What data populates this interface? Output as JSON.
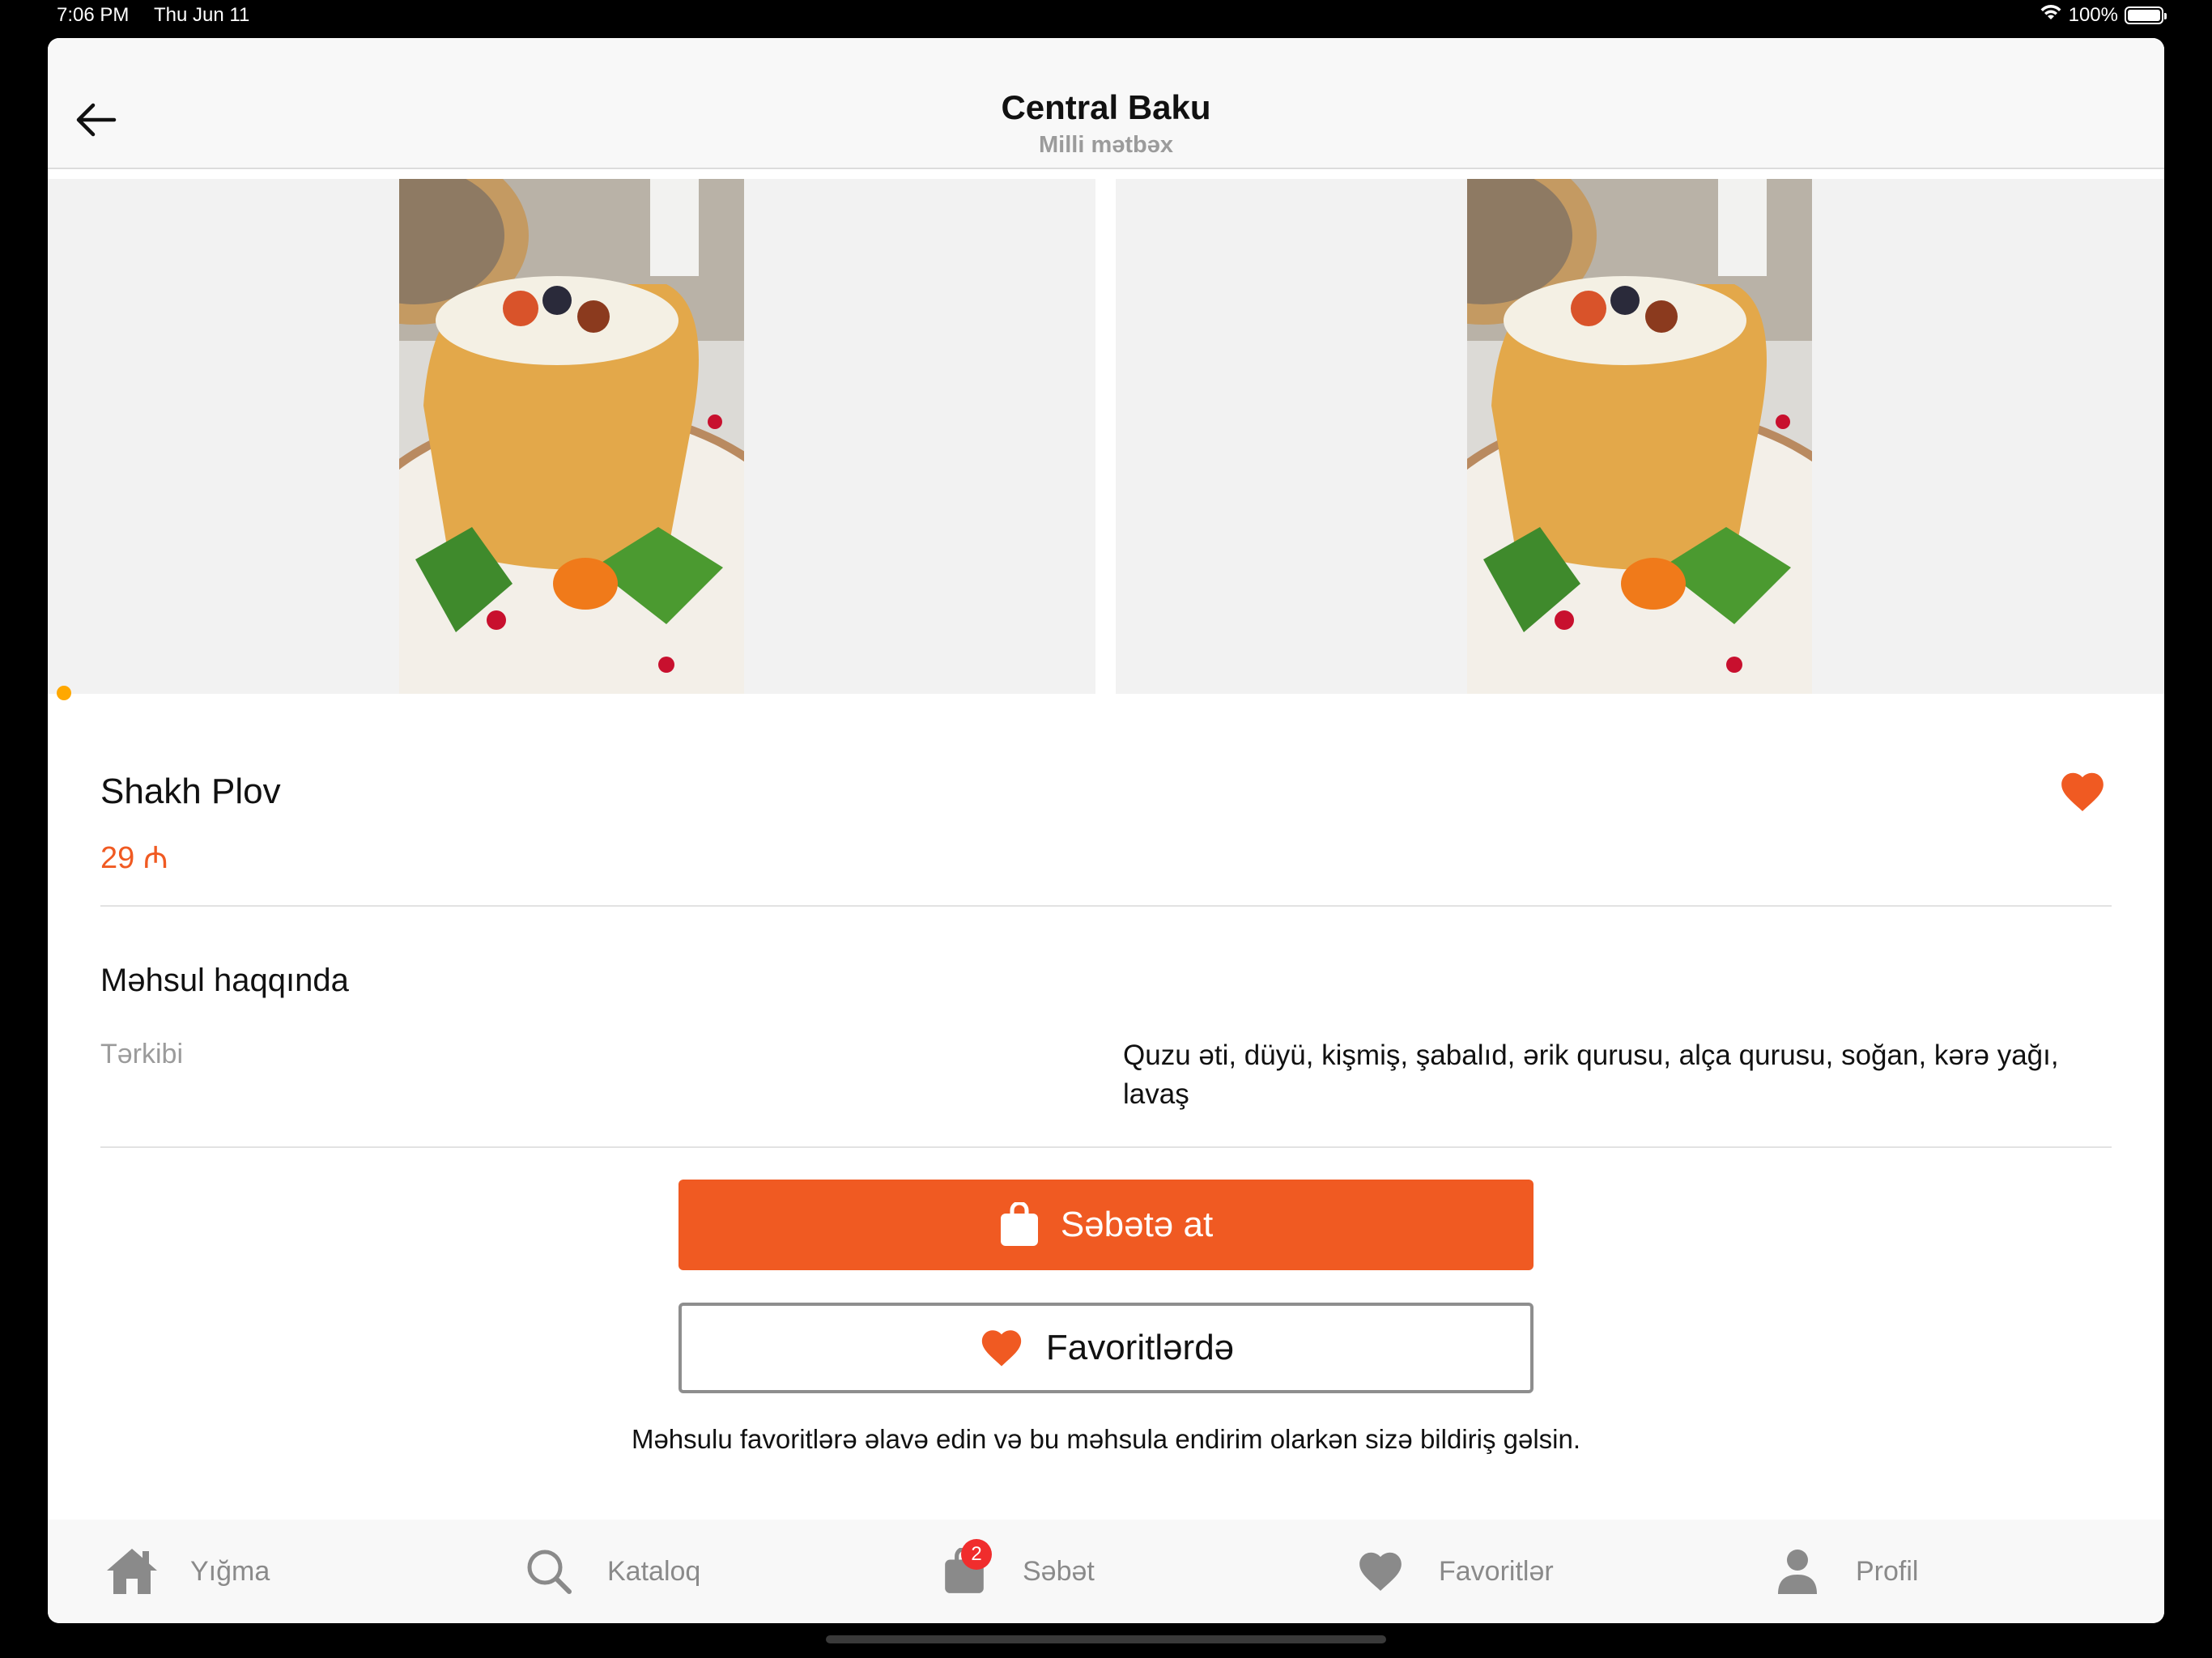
{
  "status_bar": {
    "time": "7:06 PM",
    "date": "Thu Jun 11",
    "battery": "100%"
  },
  "header": {
    "title": "Central Baku",
    "subtitle": "Milli mətbəx"
  },
  "product": {
    "name": "Shakh Plov",
    "price": "29 ₼",
    "is_favorite": true,
    "gallery_page_count": 2,
    "gallery_current_page": 1
  },
  "about": {
    "title": "Məhsul haqqında",
    "ingredients_label": "Tərkibi",
    "ingredients_value": "Quzu əti, düyü, kişmiş, şabalıd, ərik qurusu, alça qurusu, soğan, kərə yağı, lavaş"
  },
  "actions": {
    "add_to_cart_label": "Səbətə at",
    "favorites_label": "Favoritlərdə",
    "favorites_hint": "Məhsulu favoritlərə əlavə edin və bu məhsula endirim olarkən sizə bildiriş gəlsin."
  },
  "tabs": [
    {
      "label": "Yığma",
      "icon": "home-icon"
    },
    {
      "label": "Kataloq",
      "icon": "search-icon"
    },
    {
      "label": "Səbət",
      "icon": "bag-icon",
      "badge": "2"
    },
    {
      "label": "Favoritlər",
      "icon": "heart-icon"
    },
    {
      "label": "Profil",
      "icon": "person-icon"
    }
  ],
  "colors": {
    "accent": "#f05a22",
    "dot": "#ffa800",
    "badge": "#f02d2d",
    "tab_inactive": "#8a8a8a"
  }
}
